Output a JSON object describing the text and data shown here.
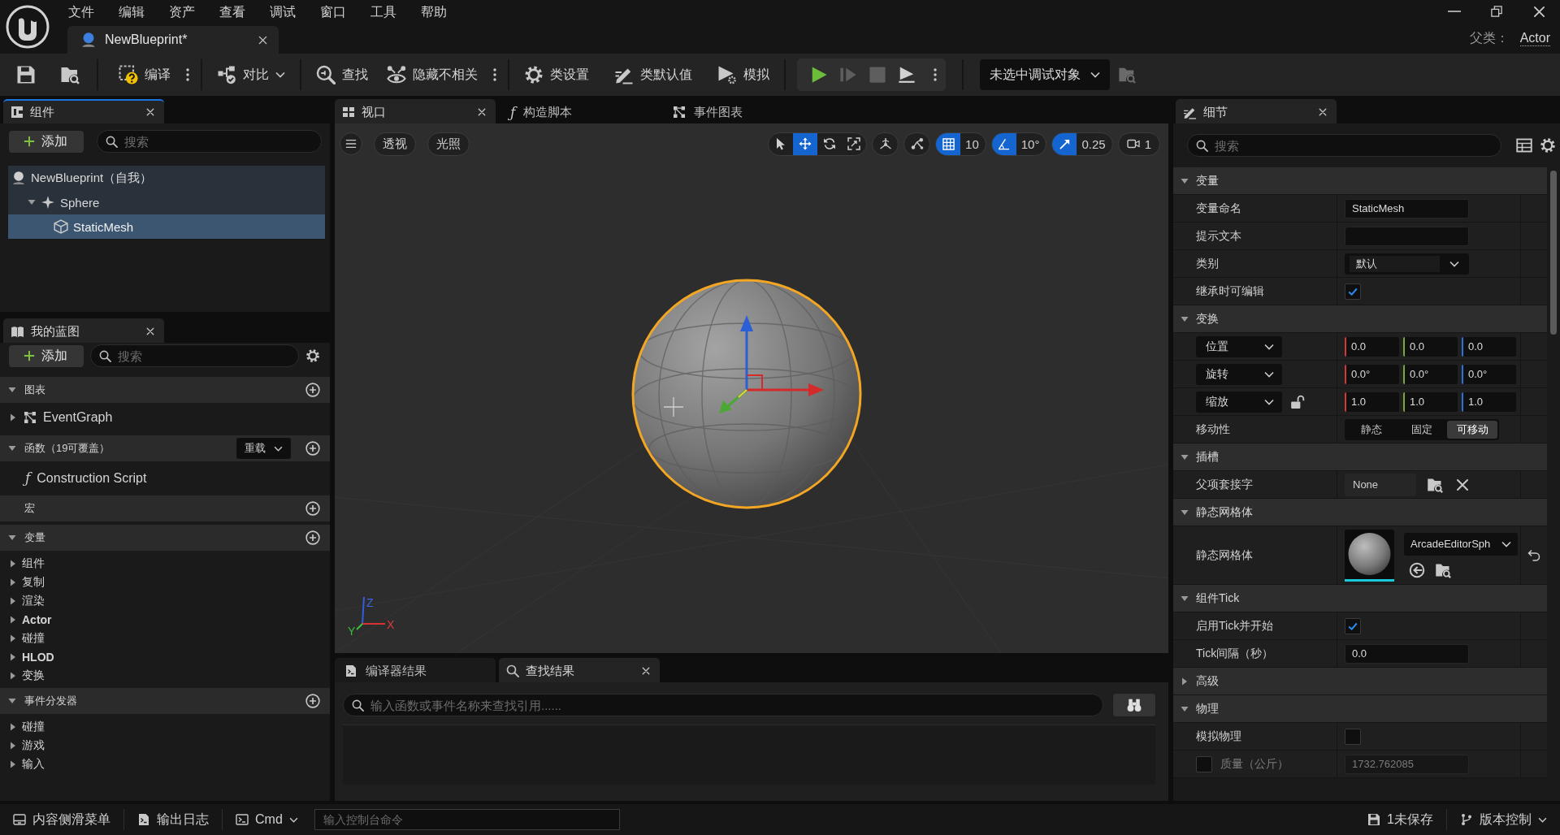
{
  "title_bar": {
    "menu": [
      "文件",
      "编辑",
      "资产",
      "查看",
      "调试",
      "窗口",
      "工具",
      "帮助"
    ],
    "document_tab": {
      "title": "NewBlueprint*"
    },
    "parent_class": {
      "label": "父类：",
      "value": "Actor"
    }
  },
  "toolbar": {
    "groups": [
      [
        {
          "kind": "save"
        },
        {
          "kind": "browse"
        }
      ],
      [
        {
          "kind": "compile",
          "label": "编译"
        },
        {
          "kind": "more"
        }
      ],
      [
        {
          "kind": "diff",
          "label": "对比"
        }
      ],
      [
        {
          "kind": "find",
          "label": "查找"
        },
        {
          "kind": "hide_unrelated",
          "label": "隐藏不相关"
        },
        {
          "kind": "more"
        }
      ],
      [
        {
          "kind": "class_settings",
          "label": "类设置"
        },
        {
          "kind": "class_defaults",
          "label": "类默认值"
        },
        {
          "kind": "simulate",
          "label": "模拟"
        }
      ],
      [
        {
          "kind": "play_controls",
          "buttons": [
            {
              "kind": "play",
              "enabled": true
            },
            {
              "kind": "advance",
              "enabled": false
            },
            {
              "kind": "stop",
              "enabled": false
            },
            {
              "kind": "eject",
              "enabled": true
            }
          ]
        }
      ],
      [
        {
          "kind": "debug_object",
          "value": "未选中调试对象"
        },
        {
          "kind": "debug_browse"
        }
      ]
    ]
  },
  "components_panel": {
    "tab": {
      "label": "组件",
      "focused": true
    },
    "add_button": "添加",
    "search": {
      "placeholder": "搜索"
    },
    "tree": [
      {
        "label": "NewBlueprint（自我）",
        "kind": "actor",
        "selected": false,
        "children": [
          {
            "label": "Sphere",
            "kind": "scene",
            "expanded": true,
            "selected": false,
            "children": [
              {
                "label": "StaticMesh",
                "kind": "mesh",
                "selected": true
              }
            ]
          }
        ]
      }
    ]
  },
  "my_blueprint_panel": {
    "tab": {
      "label": "我的蓝图",
      "focused": false
    },
    "add_button": "添加",
    "search": {
      "placeholder": "搜索"
    },
    "sections": [
      {
        "title": "图表",
        "expanded": true,
        "items": [
          {
            "label": "EventGraph",
            "kind": "graph",
            "expanded": false
          }
        ]
      },
      {
        "title": "函数（19可覆盖）",
        "expanded": true,
        "override_button": "重载",
        "items": [
          {
            "label": "Construction Script",
            "kind": "function",
            "glyph": "ƒ"
          }
        ]
      },
      {
        "title": "宏"
      },
      {
        "title": "变量",
        "expanded": true,
        "items": [
          {
            "label": "组件",
            "kind": "category",
            "bold": false,
            "expanded": false
          },
          {
            "label": "复制",
            "kind": "category",
            "bold": false,
            "expanded": false
          },
          {
            "label": "渲染",
            "kind": "category",
            "bold": false,
            "expanded": false
          },
          {
            "label": "Actor",
            "kind": "category",
            "bold": true,
            "expanded": false
          },
          {
            "label": "碰撞",
            "kind": "category",
            "bold": false,
            "expanded": false
          },
          {
            "label": "HLOD",
            "kind": "category",
            "bold": true,
            "expanded": false
          },
          {
            "label": "变换",
            "kind": "category",
            "bold": false,
            "expanded": false
          }
        ]
      },
      {
        "title": "事件分发器",
        "expanded": true,
        "items": [
          {
            "label": "碰撞",
            "kind": "category",
            "bold": false,
            "expanded": false
          },
          {
            "label": "游戏",
            "kind": "category",
            "bold": false,
            "expanded": false
          },
          {
            "label": "输入",
            "kind": "category",
            "bold": false,
            "expanded": false
          }
        ]
      }
    ]
  },
  "viewport_panel": {
    "tabs": [
      {
        "label": "视口",
        "kind": "viewport",
        "selected": true
      },
      {
        "label": "构造脚本",
        "kind": "script",
        "glyph": "ƒ",
        "selected": false
      },
      {
        "label": "事件图表",
        "kind": "graph",
        "selected": false
      }
    ],
    "view_buttons": [
      "透视",
      "光照"
    ],
    "transform_tools": [
      {
        "kind": "select",
        "selected": false
      },
      {
        "kind": "translate",
        "selected": true
      },
      {
        "kind": "rotate",
        "selected": false
      },
      {
        "kind": "scale",
        "selected": false
      }
    ],
    "snaps": [
      {
        "kind": "grid",
        "on": true,
        "value": "10"
      },
      {
        "kind": "angle",
        "on": true,
        "value": "10°"
      },
      {
        "kind": "scale",
        "on": true,
        "value": "0.25"
      }
    ],
    "camera_speed": "1",
    "axis_labels": [
      "Z",
      "X",
      "Y"
    ]
  },
  "results_panel": {
    "tabs": [
      {
        "label": "编译器结果",
        "kind": "compiler",
        "selected": false
      },
      {
        "label": "查找结果",
        "kind": "find",
        "selected": true
      }
    ],
    "search": {
      "placeholder": "输入函数或事件名称来查找引用......"
    }
  },
  "details_panel": {
    "tab": {
      "label": "细节",
      "focused": false
    },
    "search": {
      "placeholder": "搜索"
    },
    "sections": [
      {
        "title": "变量",
        "expanded": true,
        "rows": [
          {
            "kind": "text",
            "label": "变量命名",
            "value": "StaticMesh"
          },
          {
            "kind": "text",
            "label": "提示文本"
          },
          {
            "kind": "combo",
            "label": "类别",
            "value": "默认"
          },
          {
            "kind": "checkbox",
            "label": "继承时可编辑",
            "checked": true
          }
        ]
      },
      {
        "title": "变换",
        "expanded": true,
        "rows": [
          {
            "kind": "vector",
            "label": "位置",
            "values": [
              "0.0",
              "0.0",
              "0.0"
            ]
          },
          {
            "kind": "vector",
            "label": "旋转",
            "values": [
              "0.0°",
              "0.0°",
              "0.0°"
            ]
          },
          {
            "kind": "vector",
            "label": "缩放",
            "locked": false,
            "values": [
              "1.0",
              "1.0",
              "1.0"
            ]
          },
          {
            "kind": "segmented",
            "label": "移动性",
            "options": [
              {
                "label": "静态",
                "selected": false
              },
              {
                "label": "固定",
                "selected": false
              },
              {
                "label": "可移动",
                "selected": true
              }
            ]
          }
        ]
      },
      {
        "title": "插槽",
        "expanded": true,
        "rows": [
          {
            "kind": "socket",
            "label": "父项套接字",
            "value": "None"
          }
        ]
      },
      {
        "title": "静态网格体",
        "expanded": true,
        "rows": [
          {
            "kind": "mesh",
            "label": "静态网格体",
            "value": "ArcadeEditorSph"
          }
        ]
      },
      {
        "title": "组件Tick",
        "expanded": true,
        "rows": [
          {
            "kind": "checkbox",
            "label": "启用Tick并开始",
            "checked": true
          },
          {
            "kind": "text",
            "label": "Tick间隔（秒）",
            "value": "0.0"
          }
        ]
      },
      {
        "title": "高级",
        "expanded": false
      },
      {
        "title": "物理",
        "expanded": true,
        "rows": [
          {
            "kind": "checkbox",
            "label": "模拟物理",
            "checked": false
          },
          {
            "kind": "override_number",
            "label": "质量（公斤）",
            "override": false,
            "value": "1732.762085"
          }
        ]
      }
    ]
  },
  "status_bar": {
    "content_drawer": "内容侧滑菜单",
    "output_log": "输出日志",
    "cmd": "Cmd",
    "console": {
      "placeholder": "输入控制台命令"
    },
    "unsaved": "1未保存",
    "source_control": "版本控制"
  }
}
